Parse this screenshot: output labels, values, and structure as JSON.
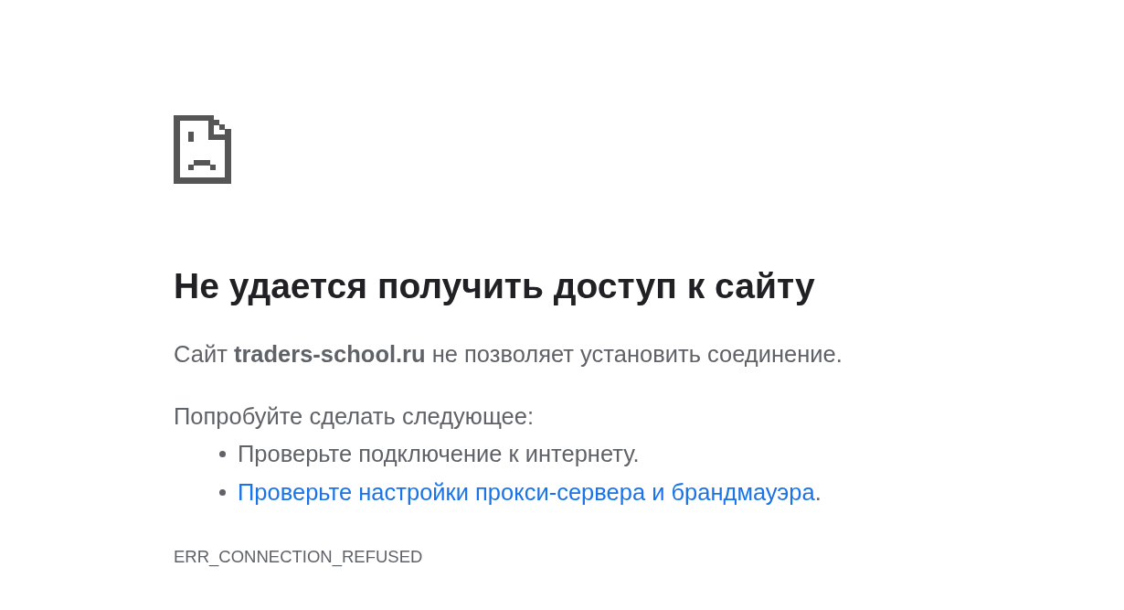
{
  "heading": "Не удается получить доступ к сайту",
  "summary": "Сайт **traders-school.ru** не позволяет установить соединение.",
  "suggestions_heading": "Попробуйте сделать следующее:",
  "suggestions": [
    {
      "kind": "text",
      "text": "Проверьте подключение к интернету."
    },
    {
      "kind": "link",
      "text": "Проверьте настройки прокси-сервера и брандмауэра",
      "after": "."
    }
  ],
  "error_code": "ERR_CONNECTION_REFUSED"
}
